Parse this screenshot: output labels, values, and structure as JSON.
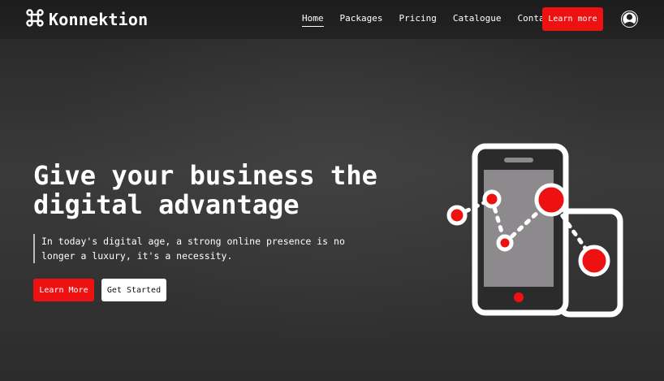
{
  "header": {
    "brand": "Konnektion",
    "nav": [
      {
        "label": "Home",
        "active": true
      },
      {
        "label": "Packages"
      },
      {
        "label": "Pricing"
      },
      {
        "label": "Catalogue"
      },
      {
        "label": "Contact"
      }
    ],
    "cta_label": "Learn more",
    "profile_icon": "user-circle-icon"
  },
  "hero": {
    "title_line1": "Give your business the",
    "title_line2": "digital advantage",
    "subtitle": "In today's digital age, a strong online presence is no longer a luxury, it's a necessity.",
    "primary_button": "Learn More",
    "secondary_button": "Get Started"
  },
  "colors": {
    "accent": "#ee1111",
    "background": "#2e2e2e",
    "text": "#ffffff"
  },
  "illustration": {
    "icon": "phone-network-illustration"
  }
}
